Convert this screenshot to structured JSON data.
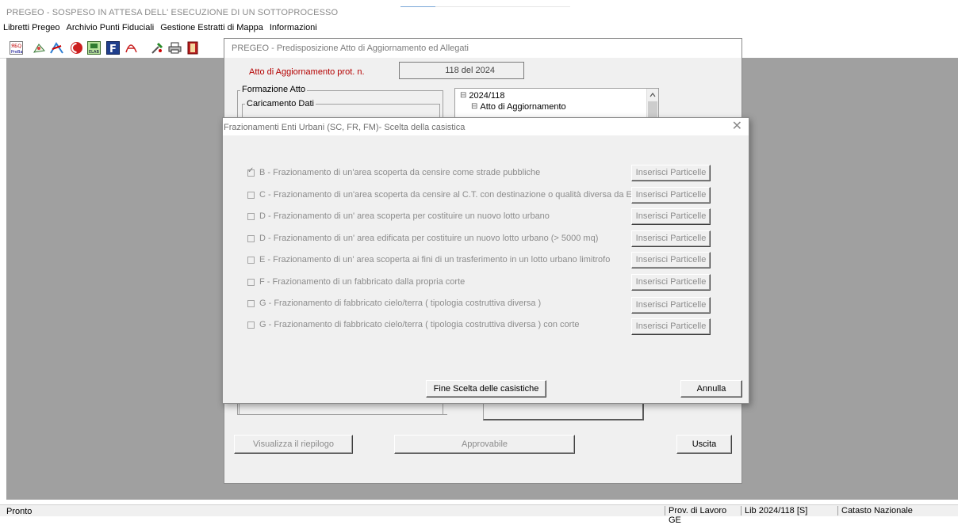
{
  "app": {
    "title": "PREGEO - SOSPESO IN ATTESA DELL' ESECUZIONE DI UN SOTTOPROCESSO",
    "menu": [
      "Libretti Pregeo",
      "Archivio Punti Fiduciali",
      "Gestione Estratti di Mappa",
      "Informazioni"
    ],
    "toolbar_icons": [
      "pregeo-icon",
      "map-icon",
      "map-edit-icon",
      "color-icon",
      "elab-icon",
      "font-icon",
      "pdf-icon",
      "tools-icon",
      "print-icon",
      "exit-icon"
    ]
  },
  "bg_dialog": {
    "title": "PREGEO - Predisposizione Atto di Aggiornamento ed Allegati",
    "prot_label": "Atto di Aggiornamento prot. n.",
    "prot_value": "118 del 2024",
    "group_formazione": "Formazione Atto",
    "group_caricamento": "Caricamento Dati",
    "tree": [
      "2024/118",
      "Atto di Aggiornamento"
    ],
    "tree_expanders": [
      "⊟",
      "⊟"
    ],
    "btn_riepilogo": "Visualizza il riepilogo",
    "btn_approvabile": "Approvabile",
    "btn_uscita": "Uscita"
  },
  "modal": {
    "title": "Frazionamenti Enti Urbani (SC, FR, FM)- Scelta della casistica",
    "close": "✕",
    "options": [
      {
        "label": "B - Frazionamento di un'area scoperta da censire come strade pubbliche",
        "checked": true
      },
      {
        "label": "C - Frazionamento di un'area scoperta da censire al C.T. con destinazione o qualità diversa da Ente Urbano",
        "checked": false
      },
      {
        "label": "D - Frazionamento di un' area scoperta per costituire un nuovo lotto urbano",
        "checked": false
      },
      {
        "label": "D - Frazionamento di un' area edificata per costituire un nuovo lotto urbano  (> 5000 mq)",
        "checked": false
      },
      {
        "label": "E - Frazionamento di un' area scoperta ai fini di un trasferimento in un lotto urbano limitrofo",
        "checked": false
      },
      {
        "label": "F - Frazionamento di un fabbricato dalla propria corte",
        "checked": false
      },
      {
        "label": "G - Frazionamento di fabbricato cielo/terra ( tipologia costruttiva diversa )",
        "checked": false
      },
      {
        "label": "G - Frazionamento di fabbricato cielo/terra ( tipologia costruttiva diversa ) con corte",
        "checked": false
      }
    ],
    "insert_btn": "Inserisci Particelle",
    "btn_fine": "Fine Scelta delle casistiche",
    "btn_annulla": "Annulla"
  },
  "status": {
    "left": "Pronto",
    "panels": [
      "Prov. di Lavoro GE",
      "Lib 2024/118 [S]",
      "Catasto Nazionale"
    ]
  }
}
